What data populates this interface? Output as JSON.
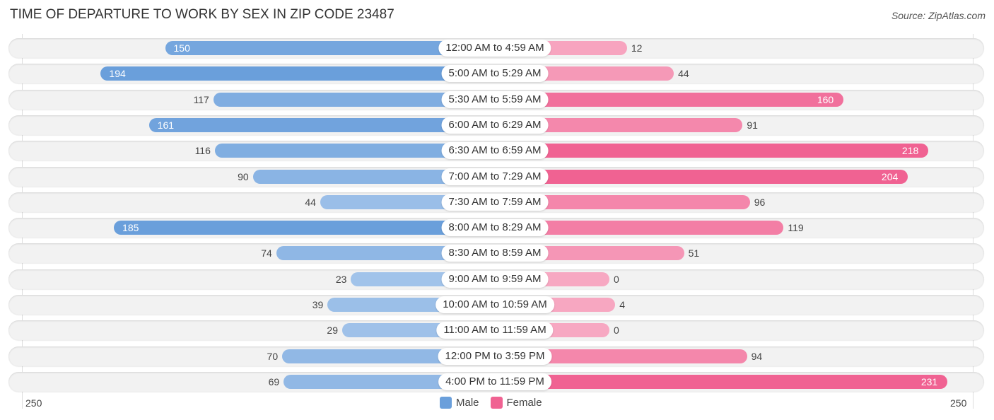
{
  "chart_data": {
    "type": "bar",
    "orientation": "horizontal-diverging",
    "title": "TIME OF DEPARTURE TO WORK BY SEX IN ZIP CODE 23487",
    "source": "Source: ZipAtlas.com",
    "categories": [
      "12:00 AM to 4:59 AM",
      "5:00 AM to 5:29 AM",
      "5:30 AM to 5:59 AM",
      "6:00 AM to 6:29 AM",
      "6:30 AM to 6:59 AM",
      "7:00 AM to 7:29 AM",
      "7:30 AM to 7:59 AM",
      "8:00 AM to 8:29 AM",
      "8:30 AM to 8:59 AM",
      "9:00 AM to 9:59 AM",
      "10:00 AM to 10:59 AM",
      "11:00 AM to 11:59 AM",
      "12:00 PM to 3:59 PM",
      "4:00 PM to 11:59 PM"
    ],
    "series": [
      {
        "name": "Male",
        "color": "#6a9fdb",
        "values": [
          150,
          194,
          117,
          161,
          116,
          90,
          44,
          185,
          74,
          23,
          39,
          29,
          70,
          69
        ]
      },
      {
        "name": "Female",
        "color": "#f06292",
        "values": [
          12,
          44,
          160,
          91,
          218,
          204,
          96,
          119,
          51,
          0,
          4,
          0,
          94,
          231
        ]
      }
    ],
    "axis": {
      "left_label": "250",
      "right_label": "250",
      "max": 250
    },
    "legend_position": "bottom-center"
  }
}
